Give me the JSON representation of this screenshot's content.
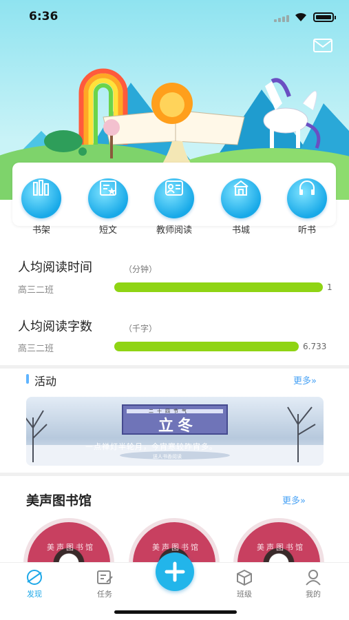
{
  "status_bar": {
    "time": "6:36"
  },
  "nav": [
    {
      "label": "书架",
      "icon": "bookshelf-icon"
    },
    {
      "label": "短文",
      "icon": "article-icon"
    },
    {
      "label": "教师阅读",
      "icon": "teacher-reading-icon"
    },
    {
      "label": "书城",
      "icon": "bookstore-icon"
    },
    {
      "label": "听书",
      "icon": "headphones-icon"
    }
  ],
  "stats": [
    {
      "title": "人均阅读时间",
      "unit": "（分钟）",
      "class_name": "高三二班",
      "value_text": "1",
      "fill": 1.0
    },
    {
      "title": "人均阅读字数",
      "unit": "（千字）",
      "class_name": "高三二班",
      "value_text": "6.733",
      "fill": 0.97
    }
  ],
  "activity": {
    "title": "活动",
    "more": "更多»",
    "banner_heading": "立冬",
    "banner_poem": "一点禅灯半轮月，今宵寒较昨宵多。",
    "banner_small_top": "二十四节气",
    "banner_small_bottom": "送人书香阅读"
  },
  "library": {
    "title": "美声图书馆",
    "more": "更多»",
    "disc_text": "美声图书馆"
  },
  "tabs": [
    {
      "label": "发现",
      "icon": "discover-icon",
      "active": true
    },
    {
      "label": "任务",
      "icon": "task-icon",
      "active": false
    },
    {
      "label": "班级",
      "icon": "class-icon",
      "active": false
    },
    {
      "label": "我的",
      "icon": "profile-icon",
      "active": false
    }
  ],
  "colors": {
    "accent": "#1ea8e8",
    "bar": "#8fd414",
    "more_link": "#4aa3f5"
  }
}
